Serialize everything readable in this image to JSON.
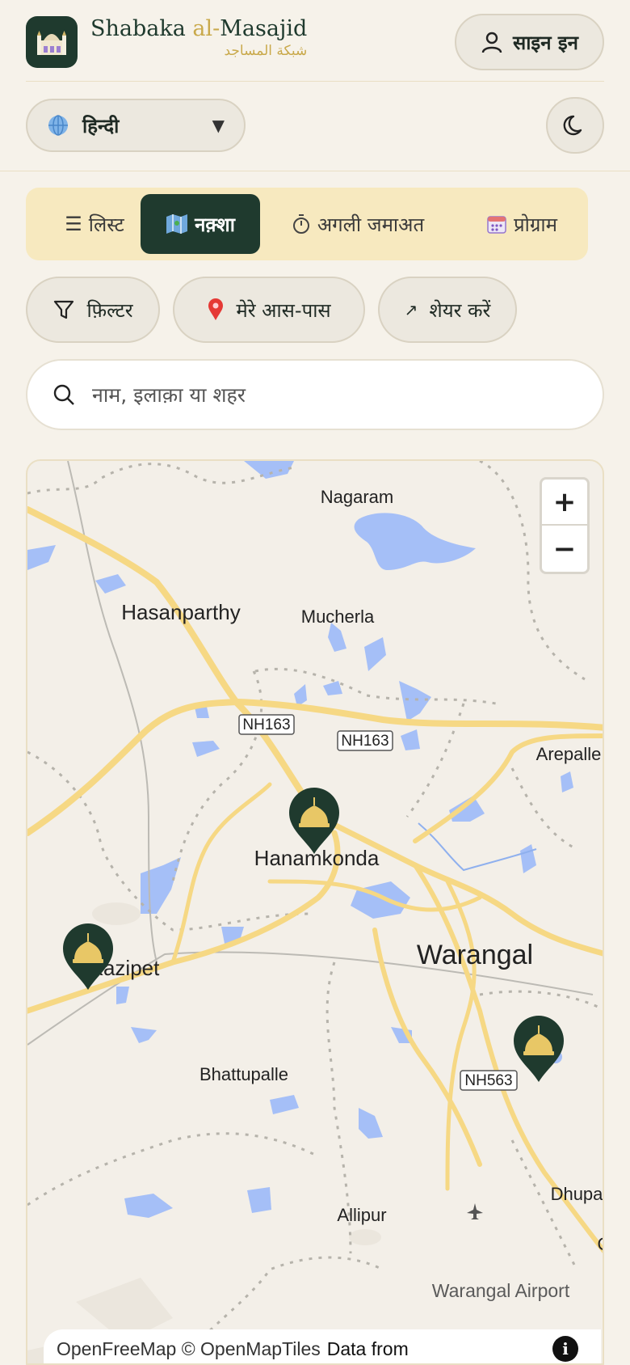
{
  "header": {
    "brand_name_prefix": "Shabaka ",
    "brand_name_al": "al-",
    "brand_name_suffix": "Masajid",
    "brand_arabic": "شبكة المساجد",
    "logo_icon": "mosque-icon",
    "signin_label": "साइन इन",
    "signin_icon": "user-icon"
  },
  "language": {
    "icon": "globe-icon",
    "selected": "हिन्दी"
  },
  "theme_icon": "moon-icon",
  "tabs": [
    {
      "label": "लिस्ट",
      "icon": "list-icon",
      "active": false
    },
    {
      "label": "नक़्शा",
      "icon": "map-icon",
      "active": true
    },
    {
      "label": "अगली जमाअत",
      "icon": "stopwatch-icon",
      "active": false
    },
    {
      "label": "प्रोग्राम",
      "icon": "calendar-icon",
      "active": false
    }
  ],
  "chips": [
    {
      "label": "फ़िल्टर",
      "icon": "filter-icon"
    },
    {
      "label": "मेरे आस-पास",
      "icon": "location-pin-icon"
    },
    {
      "label": "शेयर करें",
      "icon": "share-arrow-icon"
    }
  ],
  "search": {
    "placeholder": "नाम, इलाक़ा या शहर",
    "value": ""
  },
  "map": {
    "places": {
      "nagaram": "Nagaram",
      "hasanparthy": "Hasanparthy",
      "mucherla": "Mucherla",
      "arepalle": "Arepalle",
      "hanamkonda": "Hanamkonda",
      "warangal": "Warangal",
      "kazipet": "Kazipet",
      "bhattupalle": "Bhattupalle",
      "dhupa": "Dhupa",
      "allipur": "Allipur",
      "airport": "Warangal Airport",
      "partial_c": "G"
    },
    "roads": {
      "nh163_a": "NH163",
      "nh163_b": "NH163",
      "nh563": "NH563"
    },
    "zoom_in": "+",
    "zoom_out": "−",
    "attribution": "OpenFreeMap © OpenMapTiles",
    "attribution_extra": "Data from",
    "info_label": "i",
    "pins": [
      "mosque-pin-hanamkonda",
      "mosque-pin-kazipet",
      "mosque-pin-warangal-east"
    ]
  },
  "colors": {
    "primary": "#1f3a2e",
    "accent_gold": "#c9a94b",
    "tab_bar": "#f7e9bf",
    "water": "#a5bff7",
    "road": "#f6d884"
  }
}
